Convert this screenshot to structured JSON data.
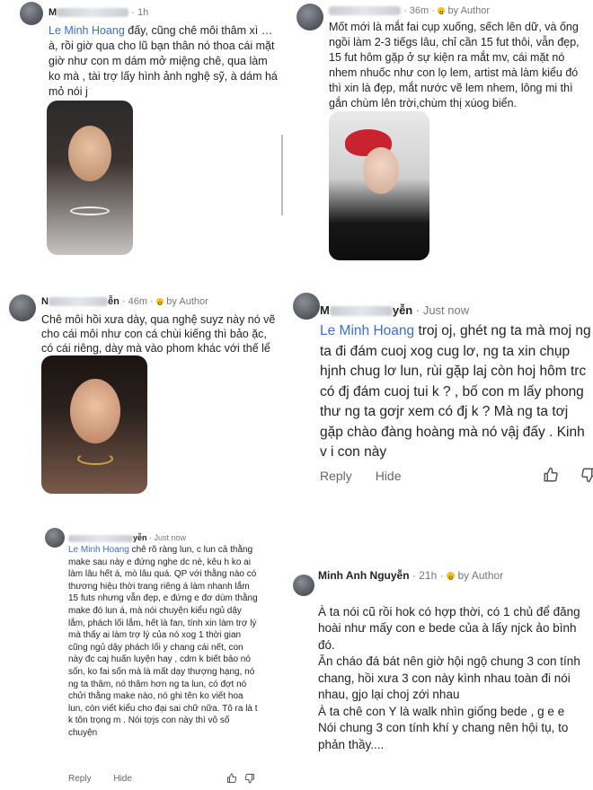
{
  "c1": {
    "time": "· 1h",
    "mention": "Le Minh Hoang",
    "text": "đấy, cũng chê môi thâm xì …à, rồi giờ qua cho lũ bạn thân nó thoa cái mặt giờ như con m dám mở miệng chê, qua làm ko mà , tài trợ lấy hình ảnh nghệ sỹ, à dám há mỏ nói j"
  },
  "c2": {
    "time": "· 36m ·",
    "badge": "by Author",
    "text": "Mốt mới là mắt fai cụp xuống, sếch lên dữ, và ống ngồi làm 2-3 tiếgs lâu, chỉ cần 15 fut thôi, vẫn đẹp, 15 fut hôm gặp ở sự kiện ra mắt mv, cái mặt nó nhem nhuốc như con lọ lem, artist mà làm kiểu đó thì xin là đẹp, mắt nước vẽ lem nhem, lông mi thì gắn chùm lên trời,chùm thị xúog biển."
  },
  "c3": {
    "name_suffix": "ễn",
    "time": "· 46m ·",
    "badge": "by Author",
    "text": "Chê môi hồi xưa dày, qua nghệ suyz này nó vẽ cho cái môi như con cá chùi kiếng thì bảo ặc, có cái riêng, dày mà vào phom khác với thế lể"
  },
  "c4": {
    "name_prefix": "M",
    "name_suffix": "yễn",
    "time": "· Just now",
    "mention": "Le Minh Hoang",
    "text": "troj oj, ghét ng ta mà moj ng ta đi đám cuoj xog cug lơ, ng ta xin chụp hjnh chug lơ lun, rùi gặp laj còn hoj hôm trc có đj đám cuoj tui k ? , bố con m lấy phong thư ng ta gơjr xem có đj k ? Mà ng ta tơj gặp chào đàng hoàng mà nó vậj đấy . Kinh v i con này",
    "reply": "Reply",
    "hide": "Hide"
  },
  "c5": {
    "name_suffix": "yễn",
    "time": "· Just now",
    "mention": "Le Minh Hoang",
    "text": "chê rõ ràng lun, c lun cả thằng make sau này e đứng nghe dc nè, kêu h ko ai làm lâu hết á, mò lâu quá. QP với thằng nào có thương hiệu thời trang riêng á làm nhanh lắm 15 futs nhưng vẫn đẹp, e đứng e đơ dùm thằng make đó lun á, mà nói chuyện kiểu ngủ dậy lắm, phách lối lắm, hết là fan, tính xin làm trợ lý mà thấy ai làm trợ lý của nó xog 1 thời gian cũng ngủ dậy phách lối y chang cái nết, con này đc caj huấn luyện hay , cdm k biết bảo nó sốn, ko fai sốn mà là mất dạy thượng hạng, nó ng ta thâm, nó thâm hơn ng ta lun, có đợt nó chửi thằng make nào, nó ghi tên ko viết hoa lun, còn viết kiểu cho đại sai chữ nữa. Tô ra là t k tôn trọng m . Nói tợjs con này thì vô số chuyện",
    "reply": "Reply",
    "hide": "Hide"
  },
  "c6": {
    "name": "Minh Anh Nguyễn",
    "time": "· 21h ·",
    "badge": "by Author",
    "text": "À ta nói cũ rồi hok có hợp thời, có 1 chủ để đăng hoài như mấy con e bede của à lấy njck ảo bình đó.\nĂn cháo đá bát nên giờ hội ngộ chung 3 con tính chang, hồi xưa 3 con này kình nhau toàn đi nói nhau, gjo lại choj zới nhau\nÀ ta chê con Y là walk nhìn giống bede , g e e\nNói chung 3 con tính khí y chang nên hội tụ, to phản thầy...."
  },
  "colors": {
    "mention": "#3b6fd1",
    "author_badge": "#f6c21b",
    "text": "#232323",
    "meta": "#777777"
  },
  "icons": [
    "thumbs-up-icon",
    "thumbs-down-icon",
    "surprised-emoji-icon"
  ]
}
